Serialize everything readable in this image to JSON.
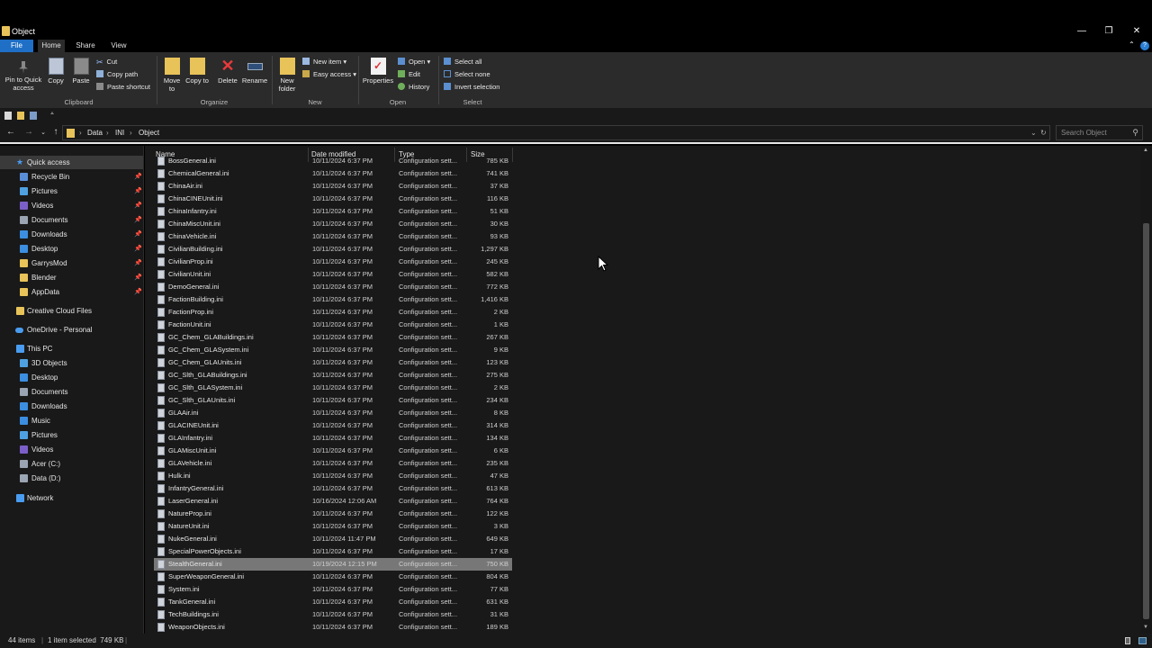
{
  "window": {
    "title": "Object",
    "minimize": "—",
    "restore": "❐",
    "close": "✕"
  },
  "ribbon_tabs": [
    "File",
    "Home",
    "Share",
    "View"
  ],
  "ribbon": {
    "clipboard": {
      "pin_label": "Pin to Quick access",
      "copy": "Copy",
      "paste": "Paste",
      "cut": "Cut",
      "copy_path": "Copy path",
      "paste_shortcut": "Paste shortcut",
      "group": "Clipboard"
    },
    "organize": {
      "move_to": "Move to",
      "copy_to": "Copy to",
      "delete": "Delete",
      "rename": "Rename",
      "group": "Organize"
    },
    "new": {
      "new_folder": "New folder",
      "new_item": "New item",
      "easy_access": "Easy access",
      "group": "New"
    },
    "open": {
      "properties": "Properties",
      "open": "Open",
      "edit": "Edit",
      "history": "History",
      "group": "Open"
    },
    "select": {
      "select_all": "Select all",
      "select_none": "Select none",
      "invert": "Invert selection",
      "group": "Select"
    }
  },
  "breadcrumb": [
    "Data",
    "INI",
    "Object"
  ],
  "search": {
    "placeholder": "Search Object"
  },
  "nav": {
    "quick_access": "Quick access",
    "quick_items": [
      "Recycle Bin",
      "Pictures",
      "Videos",
      "Documents",
      "Downloads",
      "Desktop",
      "GarrysMod",
      "Blender",
      "AppData"
    ],
    "creative_cloud": "Creative Cloud Files",
    "onedrive": "OneDrive - Personal",
    "this_pc": "This PC",
    "pc_items": [
      "3D Objects",
      "Desktop",
      "Documents",
      "Downloads",
      "Music",
      "Pictures",
      "Videos",
      "Acer (C:)",
      "Data (D:)"
    ],
    "network": "Network"
  },
  "columns": {
    "name": "Name",
    "date": "Date modified",
    "type": "Type",
    "size": "Size"
  },
  "files": [
    {
      "name": "BossGeneral.ini",
      "date": "10/11/2024 6:37 PM",
      "type": "Configuration sett...",
      "size": "785 KB"
    },
    {
      "name": "ChemicalGeneral.ini",
      "date": "10/11/2024 6:37 PM",
      "type": "Configuration sett...",
      "size": "741 KB"
    },
    {
      "name": "ChinaAir.ini",
      "date": "10/11/2024 6:37 PM",
      "type": "Configuration sett...",
      "size": "37 KB"
    },
    {
      "name": "ChinaCINEUnit.ini",
      "date": "10/11/2024 6:37 PM",
      "type": "Configuration sett...",
      "size": "116 KB"
    },
    {
      "name": "ChinaInfantry.ini",
      "date": "10/11/2024 6:37 PM",
      "type": "Configuration sett...",
      "size": "51 KB"
    },
    {
      "name": "ChinaMiscUnit.ini",
      "date": "10/11/2024 6:37 PM",
      "type": "Configuration sett...",
      "size": "30 KB"
    },
    {
      "name": "ChinaVehicle.ini",
      "date": "10/11/2024 6:37 PM",
      "type": "Configuration sett...",
      "size": "93 KB"
    },
    {
      "name": "CivilianBuilding.ini",
      "date": "10/11/2024 6:37 PM",
      "type": "Configuration sett...",
      "size": "1,297 KB"
    },
    {
      "name": "CivilianProp.ini",
      "date": "10/11/2024 6:37 PM",
      "type": "Configuration sett...",
      "size": "245 KB"
    },
    {
      "name": "CivilianUnit.ini",
      "date": "10/11/2024 6:37 PM",
      "type": "Configuration sett...",
      "size": "582 KB"
    },
    {
      "name": "DemoGeneral.ini",
      "date": "10/11/2024 6:37 PM",
      "type": "Configuration sett...",
      "size": "772 KB"
    },
    {
      "name": "FactionBuilding.ini",
      "date": "10/11/2024 6:37 PM",
      "type": "Configuration sett...",
      "size": "1,416 KB"
    },
    {
      "name": "FactionProp.ini",
      "date": "10/11/2024 6:37 PM",
      "type": "Configuration sett...",
      "size": "2 KB"
    },
    {
      "name": "FactionUnit.ini",
      "date": "10/11/2024 6:37 PM",
      "type": "Configuration sett...",
      "size": "1 KB"
    },
    {
      "name": "GC_Chem_GLABuildings.ini",
      "date": "10/11/2024 6:37 PM",
      "type": "Configuration sett...",
      "size": "267 KB"
    },
    {
      "name": "GC_Chem_GLASystem.ini",
      "date": "10/11/2024 6:37 PM",
      "type": "Configuration sett...",
      "size": "9 KB"
    },
    {
      "name": "GC_Chem_GLAUnits.ini",
      "date": "10/11/2024 6:37 PM",
      "type": "Configuration sett...",
      "size": "123 KB"
    },
    {
      "name": "GC_Slth_GLABuildings.ini",
      "date": "10/11/2024 6:37 PM",
      "type": "Configuration sett...",
      "size": "275 KB"
    },
    {
      "name": "GC_Slth_GLASystem.ini",
      "date": "10/11/2024 6:37 PM",
      "type": "Configuration sett...",
      "size": "2 KB"
    },
    {
      "name": "GC_Slth_GLAUnits.ini",
      "date": "10/11/2024 6:37 PM",
      "type": "Configuration sett...",
      "size": "234 KB"
    },
    {
      "name": "GLAAir.ini",
      "date": "10/11/2024 6:37 PM",
      "type": "Configuration sett...",
      "size": "8 KB"
    },
    {
      "name": "GLACINEUnit.ini",
      "date": "10/11/2024 6:37 PM",
      "type": "Configuration sett...",
      "size": "314 KB"
    },
    {
      "name": "GLAInfantry.ini",
      "date": "10/11/2024 6:37 PM",
      "type": "Configuration sett...",
      "size": "134 KB"
    },
    {
      "name": "GLAMiscUnit.ini",
      "date": "10/11/2024 6:37 PM",
      "type": "Configuration sett...",
      "size": "6 KB"
    },
    {
      "name": "GLAVehicle.ini",
      "date": "10/11/2024 6:37 PM",
      "type": "Configuration sett...",
      "size": "235 KB"
    },
    {
      "name": "Hulk.ini",
      "date": "10/11/2024 6:37 PM",
      "type": "Configuration sett...",
      "size": "47 KB"
    },
    {
      "name": "InfantryGeneral.ini",
      "date": "10/11/2024 6:37 PM",
      "type": "Configuration sett...",
      "size": "613 KB"
    },
    {
      "name": "LaserGeneral.ini",
      "date": "10/16/2024 12:06 AM",
      "type": "Configuration sett...",
      "size": "764 KB"
    },
    {
      "name": "NatureProp.ini",
      "date": "10/11/2024 6:37 PM",
      "type": "Configuration sett...",
      "size": "122 KB"
    },
    {
      "name": "NatureUnit.ini",
      "date": "10/11/2024 6:37 PM",
      "type": "Configuration sett...",
      "size": "3 KB"
    },
    {
      "name": "NukeGeneral.ini",
      "date": "10/11/2024 11:47 PM",
      "type": "Configuration sett...",
      "size": "649 KB"
    },
    {
      "name": "SpecialPowerObjects.ini",
      "date": "10/11/2024 6:37 PM",
      "type": "Configuration sett...",
      "size": "17 KB"
    },
    {
      "name": "StealthGeneral.ini",
      "date": "10/19/2024 12:15 PM",
      "type": "Configuration sett...",
      "size": "750 KB",
      "selected": true
    },
    {
      "name": "SuperWeaponGeneral.ini",
      "date": "10/11/2024 6:37 PM",
      "type": "Configuration sett...",
      "size": "804 KB"
    },
    {
      "name": "System.ini",
      "date": "10/11/2024 6:37 PM",
      "type": "Configuration sett...",
      "size": "77 KB"
    },
    {
      "name": "TankGeneral.ini",
      "date": "10/11/2024 6:37 PM",
      "type": "Configuration sett...",
      "size": "631 KB"
    },
    {
      "name": "TechBuildings.ini",
      "date": "10/11/2024 6:37 PM",
      "type": "Configuration sett...",
      "size": "31 KB"
    },
    {
      "name": "WeaponObjects.ini",
      "date": "10/11/2024 6:37 PM",
      "type": "Configuration sett...",
      "size": "189 KB"
    }
  ],
  "status": {
    "items": "44 items",
    "selected": "1 item selected  749 KB"
  },
  "colors": {
    "accent": "#1f6fc6",
    "folder": "#e8c35a",
    "selected_row": "#777777"
  }
}
